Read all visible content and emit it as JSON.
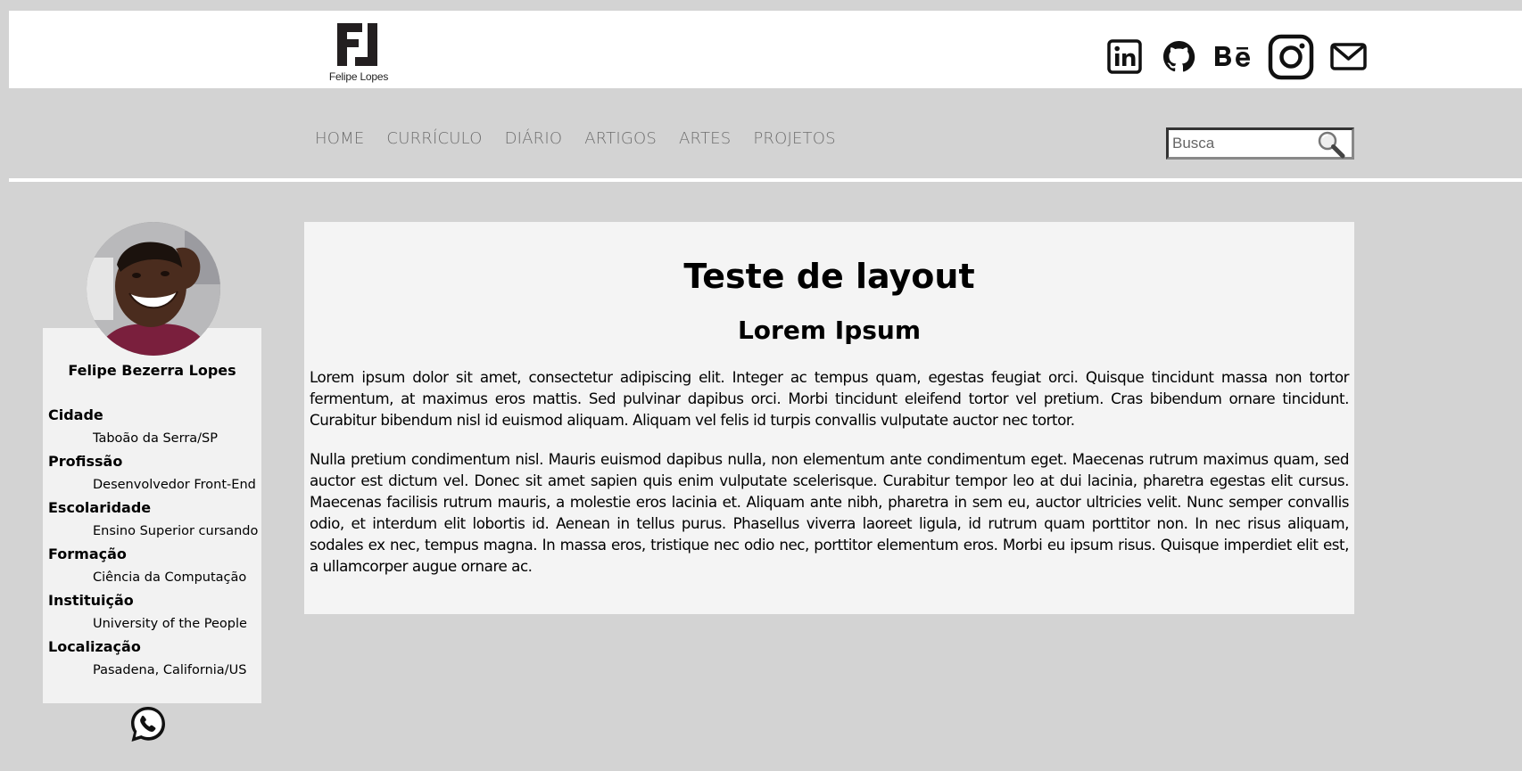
{
  "logo": {
    "caption": "Felipe Lopes",
    "monogram": "FL"
  },
  "social": [
    {
      "name": "linkedin",
      "icon": "linkedin-icon"
    },
    {
      "name": "github",
      "icon": "github-icon"
    },
    {
      "name": "behance",
      "icon": "behance-icon"
    },
    {
      "name": "instagram",
      "icon": "instagram-icon"
    },
    {
      "name": "email",
      "icon": "mail-icon"
    }
  ],
  "nav": {
    "home": "HOME",
    "curriculo": "CURRÍCULO",
    "diario": "DIÁRIO",
    "artigos": "ARTIGOS",
    "artes": "ARTES",
    "projetos": "PROJETOS"
  },
  "search": {
    "placeholder": "Busca",
    "value": ""
  },
  "profile": {
    "name": "Felipe Bezerra Lopes",
    "fields": [
      {
        "label": "Cidade",
        "value": "Taboão da Serra/SP"
      },
      {
        "label": "Profissão",
        "value": "Desenvolvedor Front-End"
      },
      {
        "label": "Escolaridade",
        "value": "Ensino Superior cursando"
      },
      {
        "label": "Formação",
        "value": "Ciência da Computação"
      },
      {
        "label": "Instituição",
        "value": "University of the People"
      },
      {
        "label": "Localização",
        "value": "Pasadena, California/US"
      }
    ]
  },
  "content": {
    "title": "Teste de layout",
    "subtitle": "Lorem Ipsum",
    "paragraphs": [
      "Lorem ipsum dolor sit amet, consectetur adipiscing elit. Integer ac tempus quam, egestas feugiat orci. Quisque tincidunt massa non tortor fermentum, at maximus eros mattis. Sed pulvinar dapibus orci. Morbi tincidunt eleifend tortor vel pretium. Cras bibendum ornare tincidunt. Curabitur bibendum nisl id euismod aliquam. Aliquam vel felis id turpis convallis vulputate auctor nec tortor.",
      "Nulla pretium condimentum nisl. Mauris euismod dapibus nulla, non elementum ante condimentum eget. Maecenas rutrum maximus quam, sed auctor est dictum vel. Donec sit amet sapien quis enim vulputate scelerisque. Curabitur tempor leo at dui lacinia, pharetra egestas elit cursus. Maecenas facilisis rutrum mauris, a molestie eros lacinia et. Aliquam ante nibh, pharetra in sem eu, auctor ultricies velit. Nunc semper convallis odio, et interdum elit lobortis id. Aenean in tellus purus. Phasellus viverra laoreet ligula, id rutrum quam porttitor non. In nec risus aliquam, sodales ex nec, tempus magna. In massa eros, tristique nec odio nec, porttitor elementum eros. Morbi eu ipsum risus. Quisque imperdiet elit est, a ullamcorper augue ornare ac."
    ]
  },
  "colors": {
    "background": "#d3d3d3",
    "header": "#ffffff",
    "panel": "#f4f4f4",
    "nav_text": "#6e6e6e"
  }
}
